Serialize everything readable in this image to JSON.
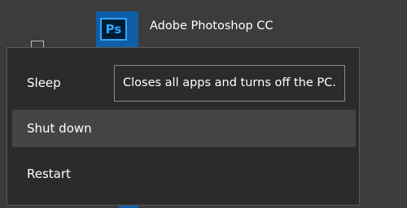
{
  "start_menu": {
    "app_tile": {
      "icon_text": "Ps",
      "name": "Adobe Photoshop CC"
    }
  },
  "power_menu": {
    "items": [
      {
        "label": "Sleep"
      },
      {
        "label": "Shut down",
        "highlighted": true
      },
      {
        "label": "Restart"
      }
    ]
  },
  "tooltip": {
    "text": "Closes all apps and turns off the PC."
  },
  "colors": {
    "tile_blue": "#0f5ea8",
    "photoshop_blue": "#31a8ff",
    "menu_bg": "#2b2b2b",
    "highlight_bg": "#444444"
  }
}
